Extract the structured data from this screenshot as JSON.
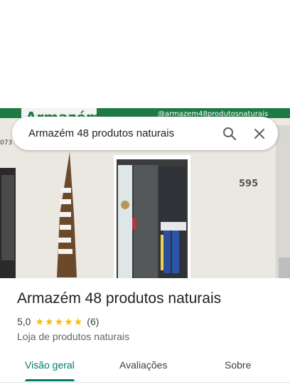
{
  "search": {
    "query": "Armazém 48 produtos naturais"
  },
  "photo": {
    "sign_left": "Armazém",
    "sign_right": "@armazem48produtosnaturais",
    "phone_fragment": "073",
    "house_number": "595"
  },
  "place": {
    "name": "Armazém 48 produtos naturais",
    "rating": "5,0",
    "stars": 5,
    "review_count": "(6)",
    "category": "Loja de produtos naturais"
  },
  "tabs": [
    {
      "label": "Visão geral",
      "active": true
    },
    {
      "label": "Avaliações",
      "active": false
    },
    {
      "label": "Sobre",
      "active": false
    }
  ],
  "colors": {
    "accent": "#00796b",
    "star": "#fbbc04",
    "sign_green": "#1e7a45"
  },
  "icons": {
    "search": "search-icon",
    "close": "close-icon"
  }
}
